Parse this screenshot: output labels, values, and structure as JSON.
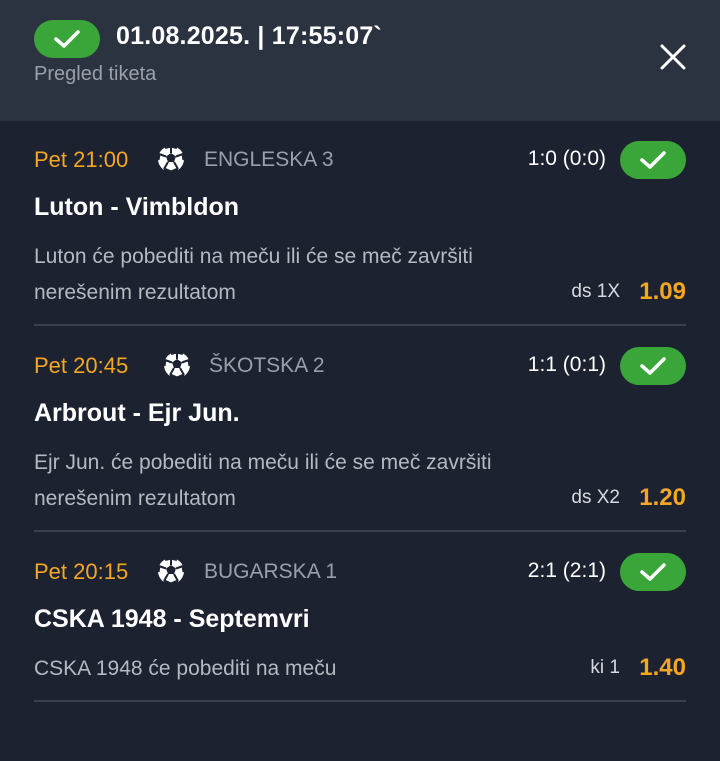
{
  "header": {
    "status_icon": "check-icon",
    "datetime": "01.08.2025. | 17:55:07`",
    "subtitle": "Pregled tiketa",
    "close_icon": "close-icon"
  },
  "colors": {
    "win_green": "#3aa63a",
    "accent_orange": "#f5a623",
    "header_bg": "#2c3340",
    "body_bg": "#1c2230"
  },
  "tickets": [
    {
      "time": "Pet 21:00",
      "sport_icon": "soccer-ball-icon",
      "league": "ENGLESKA 3",
      "score": "1:0 (0:0)",
      "status_icon": "check-icon",
      "match": "Luton - Vimbldon",
      "description": "Luton će pobediti na meču ili će se meč završiti nerešenim rezultatom",
      "bet_type": "ds 1X",
      "odds": "1.09"
    },
    {
      "time": "Pet 20:45",
      "sport_icon": "soccer-ball-icon",
      "league": "ŠKOTSKA 2",
      "score": "1:1 (0:1)",
      "status_icon": "check-icon",
      "match": "Arbrout - Ejr Jun.",
      "description": "Ejr Jun. će pobediti na meču ili će se meč završiti nerešenim rezultatom",
      "bet_type": "ds X2",
      "odds": "1.20"
    },
    {
      "time": "Pet 20:15",
      "sport_icon": "soccer-ball-icon",
      "league": "BUGARSKA 1",
      "score": "2:1 (2:1)",
      "status_icon": "check-icon",
      "match": "CSKA 1948 - Septemvri",
      "description": "CSKA 1948 će pobediti na meču",
      "bet_type": "ki 1",
      "odds": "1.40"
    }
  ]
}
